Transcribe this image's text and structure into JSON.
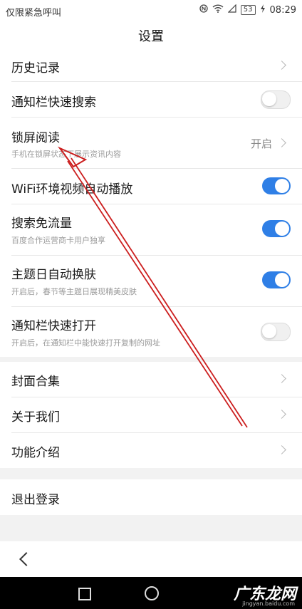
{
  "status_bar": {
    "carrier": "仅限紧急呼叫",
    "battery": "53",
    "time": "08:29"
  },
  "header": {
    "title": "设置"
  },
  "group1": [
    {
      "title": "历史记录",
      "type": "chevron"
    },
    {
      "title": "通知栏快速搜索",
      "type": "toggle",
      "on": false
    },
    {
      "title": "锁屏阅读",
      "subtitle": "手机在锁屏状态下展示资讯内容",
      "value": "开启",
      "type": "chevron"
    },
    {
      "title": "WiFi环境视频自动播放",
      "type": "toggle",
      "on": true
    },
    {
      "title": "搜索免流量",
      "subtitle": "百度合作运营商卡用户独享",
      "type": "toggle",
      "on": true
    },
    {
      "title": "主题日自动换肤",
      "subtitle": "开启后，春节等主题日展现精美皮肤",
      "type": "toggle",
      "on": true
    },
    {
      "title": "通知栏快速打开",
      "subtitle": "开启后，在通知栏中能快速打开复制的网址",
      "type": "toggle",
      "on": false
    }
  ],
  "group2": [
    {
      "title": "封面合集"
    },
    {
      "title": "关于我们"
    },
    {
      "title": "功能介绍"
    }
  ],
  "logout": {
    "label": "退出登录"
  },
  "watermark": {
    "text": "广东龙网",
    "sub": "jingyan.baidu.com"
  },
  "colors": {
    "toggle_on": "#2f7fe6",
    "arrow": "#cc1f1f"
  }
}
